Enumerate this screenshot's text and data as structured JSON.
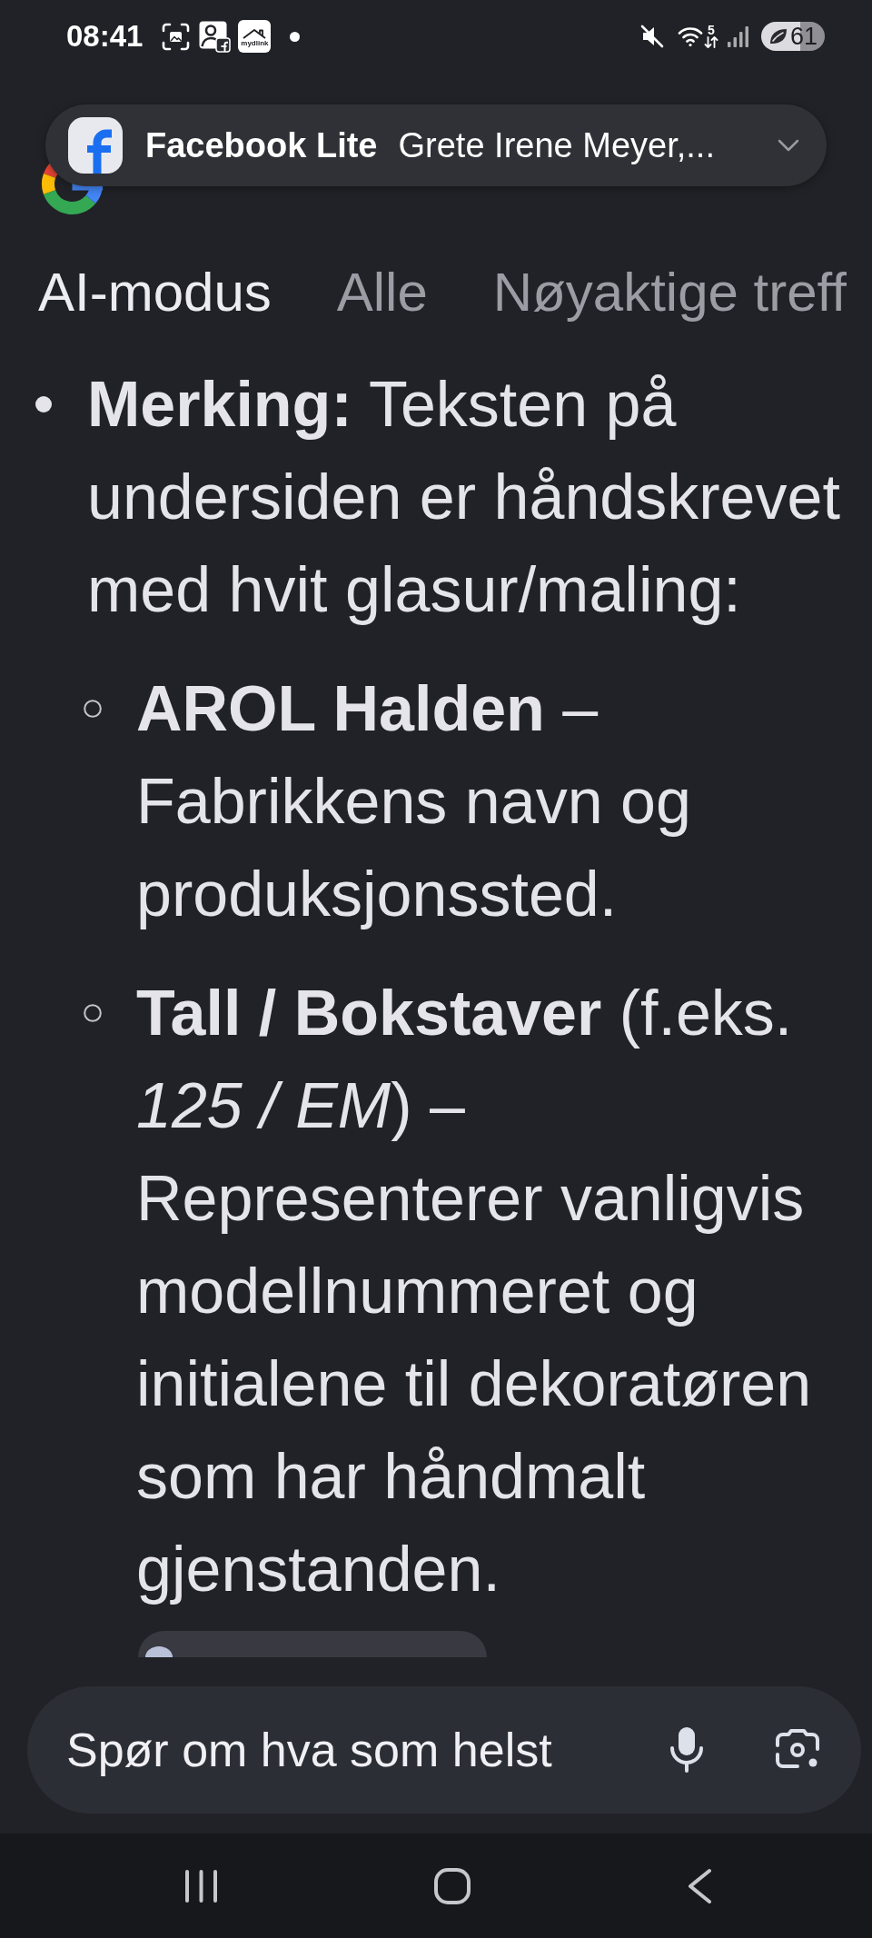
{
  "status_bar": {
    "time": "08:41",
    "app_logo_label": "mydlink",
    "wifi_standard": "5",
    "battery": "61"
  },
  "notification": {
    "app": "Facebook Lite",
    "text": "Grete Irene Meyer,..."
  },
  "tabs": [
    {
      "label": "AI-modus",
      "selected": true
    },
    {
      "label": "Alle",
      "selected": false
    },
    {
      "label": "Nøyaktige treff",
      "selected": false
    }
  ],
  "answer": {
    "items": [
      {
        "text": "**Merking:** Teksten på undersiden er håndskrevet med hvit glasur/maling:",
        "children": [
          {
            "text": "**AROL Halden** – Fabrikkens navn og produksjonssted."
          },
          {
            "text": "**Tall / Bokstaver** (f.eks. *125 / EM*) – Representerer vanligvis modellnummeret og initialene til dekoratøren som har håndmalt gjenstanden."
          }
        ]
      }
    ]
  },
  "search": {
    "placeholder": "Spør om hva som helst"
  }
}
